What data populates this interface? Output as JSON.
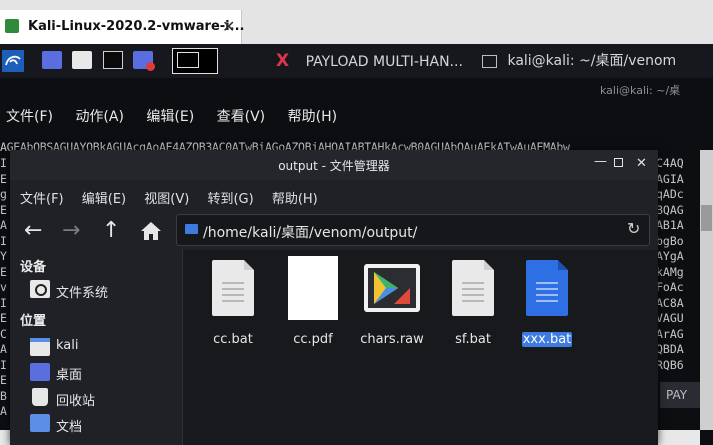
{
  "host": {
    "tab_title": "Kali-Linux-2020.2-vmware-i...",
    "tab_close": "✕"
  },
  "panel": {
    "tasks": [
      {
        "label": "PAYLOAD MULTI-HAN..."
      },
      {
        "label": "kali@kali: ~/桌面/venom"
      }
    ]
  },
  "terminal": {
    "title_right": "kali@kali: ~/桌",
    "menu": [
      "文件(F)",
      "动作(A)",
      "编辑(E)",
      "查看(V)",
      "帮助(H)"
    ],
    "first_line": "AGEAbQBSAGUAYQBkAGUAcgAoAE4AZQB3AC0ATwBiAGoAZQBjAHQAIABTAHkAcwB0AGUAbQAuAEkATwAuAEMAbw",
    "right_col": [
      "C4AQ",
      "AGIA",
      "qADc",
      "BQAG",
      "AB1A",
      "bgBo",
      "AYgA",
      "kAMg",
      "FoAc",
      "AC8A",
      "VAGU",
      "ArAG",
      "QBDA",
      "RQB6"
    ],
    "left_col": [
      "I",
      "E",
      "g",
      "E",
      "A",
      "I",
      "Y",
      "E",
      "v",
      "I",
      "E",
      "C",
      "A",
      "I",
      "E",
      "B",
      "A"
    ],
    "bottom_tab": "PAY"
  },
  "filemanager": {
    "title": "output - 文件管理器",
    "menu": [
      "文件(F)",
      "编辑(E)",
      "视图(V)",
      "转到(G)",
      "帮助(H)"
    ],
    "path": "/home/kali/桌面/venom/output/",
    "side": {
      "devices_header": "设备",
      "devices": [
        "文件系统"
      ],
      "places_header": "位置",
      "places": [
        "kali",
        "桌面",
        "回收站",
        "文档"
      ]
    },
    "files": [
      {
        "name": "cc.bat",
        "kind": "text"
      },
      {
        "name": "cc.pdf",
        "kind": "pdf"
      },
      {
        "name": "chars.raw",
        "kind": "raw"
      },
      {
        "name": "sf.bat",
        "kind": "text"
      },
      {
        "name": "xxx.bat",
        "kind": "text-selected"
      }
    ]
  },
  "colors": {
    "accent": "#3d7be0",
    "selection": "#3d7be0"
  }
}
